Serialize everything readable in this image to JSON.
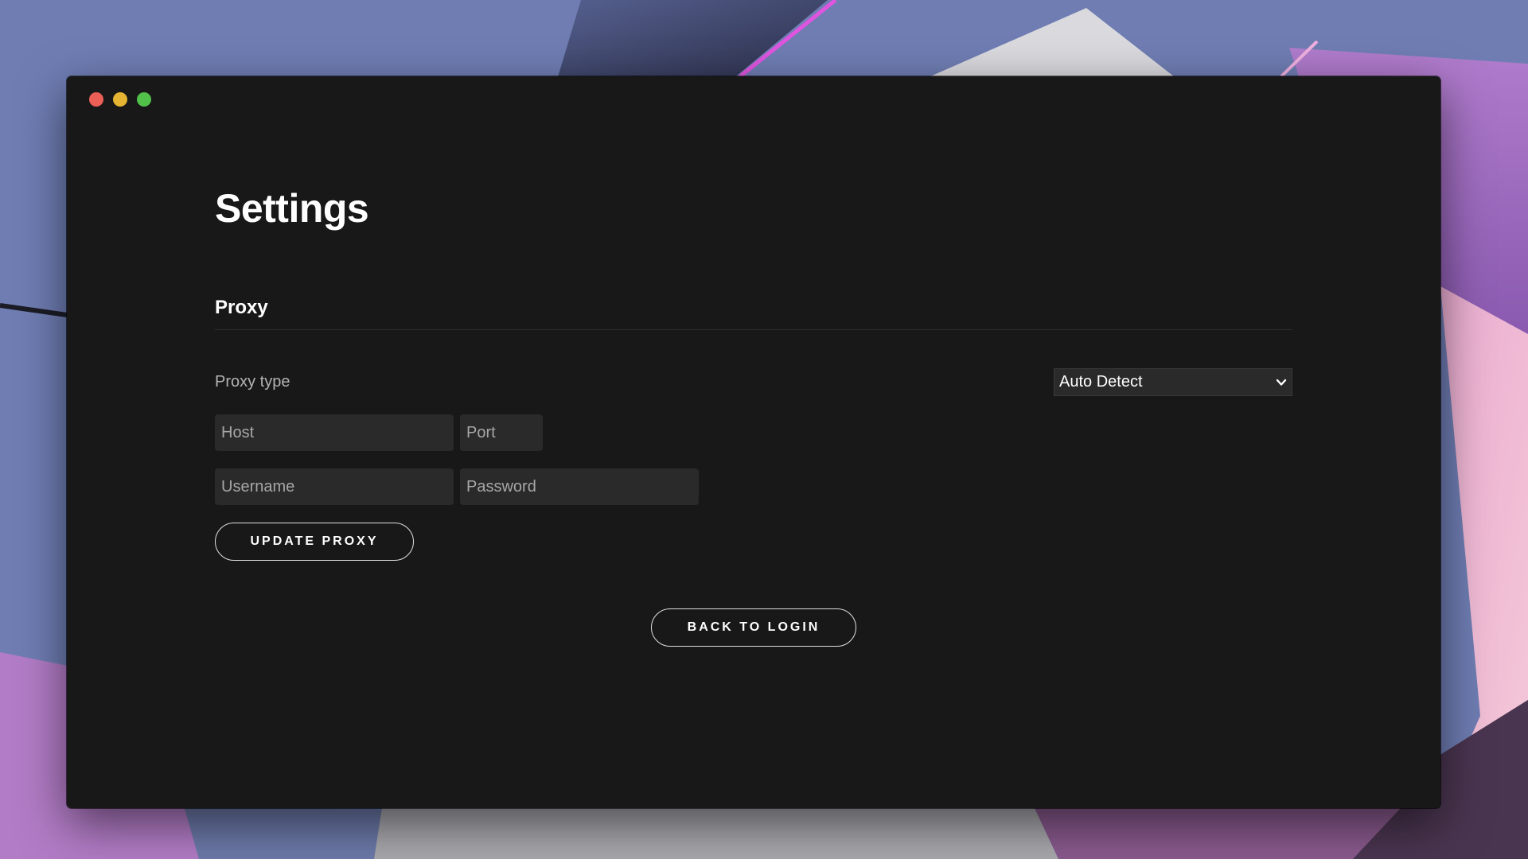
{
  "colors": {
    "window_bg": "#181818",
    "close": "#ec5f57",
    "minimize": "#e4b432",
    "zoom": "#52c14a",
    "field_bg": "#2a2a2a",
    "accent_text": "#ffffff"
  },
  "page": {
    "title": "Settings"
  },
  "proxy": {
    "section_title": "Proxy",
    "type_label": "Proxy type",
    "type_selected": "Auto Detect",
    "host_placeholder": "Host",
    "port_placeholder": "Port",
    "username_placeholder": "Username",
    "password_placeholder": "Password",
    "update_label": "UPDATE PROXY"
  },
  "footer": {
    "back_label": "BACK TO LOGIN"
  },
  "icons": {
    "select_arrow": "chevron-down-icon"
  }
}
